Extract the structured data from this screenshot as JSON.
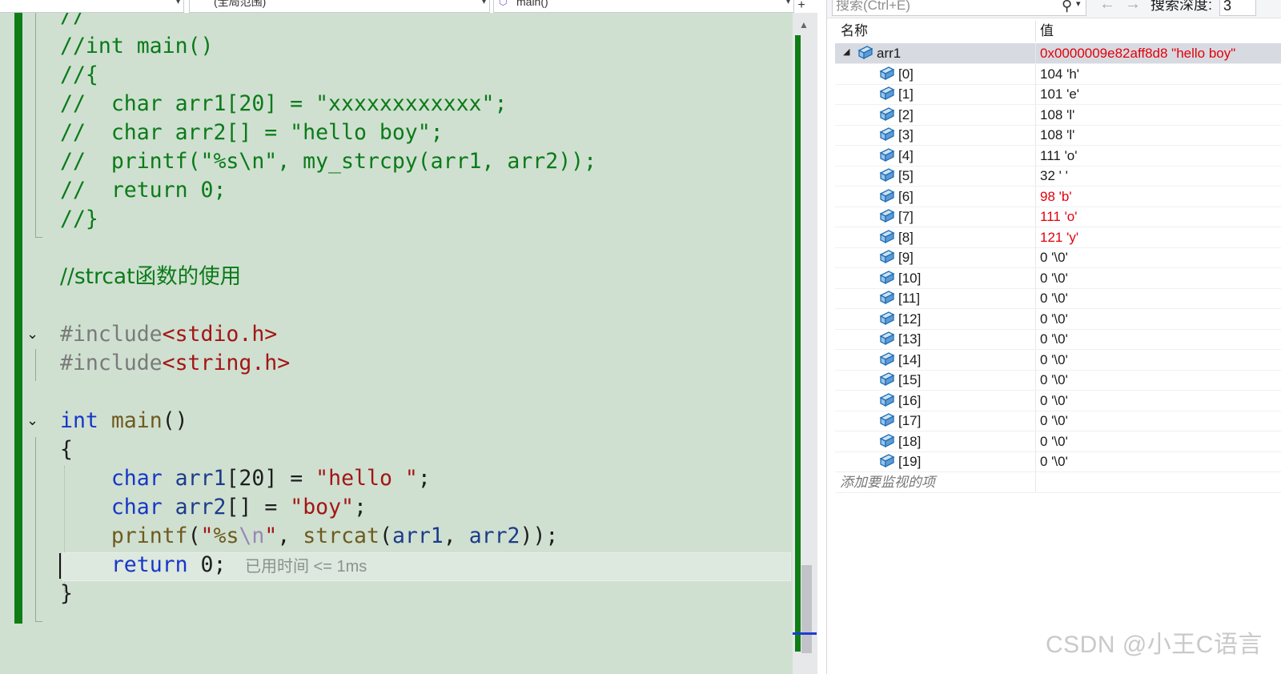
{
  "navbar": {
    "scope": "(全局范围)",
    "method": "main()",
    "split": "+"
  },
  "code": {
    "lines": [
      "//",
      "//int main()",
      "//{",
      "//  char arr1[20] = \"xxxxxxxxxxxx\";",
      "//  char arr2[] = \"hello boy\";",
      "//  printf(\"%s\\n\", my_strcpy(arr1, arr2));",
      "//  return 0;",
      "//}",
      "",
      "//strcat函数的使用",
      "",
      "#include<stdio.h>",
      "#include<string.h>",
      "",
      "int main()",
      "{",
      "    char arr1[20] = \"hello \";",
      "    char arr2[] = \"boy\";",
      "    printf(\"%s\\n\", strcat(arr1, arr2));",
      "    return 0;",
      "}"
    ],
    "perf_tip": "已用时间 <= 1ms"
  },
  "watch": {
    "search_placeholder": "搜索(Ctrl+E)",
    "depth_label": "搜索深度:",
    "depth_value": "3",
    "col_name": "名称",
    "col_value": "值",
    "root": {
      "name": "arr1",
      "value": "0x0000009e82aff8d8 \"hello boy\"",
      "expanded": true,
      "changed": true
    },
    "items": [
      {
        "name": "[0]",
        "value": "104 'h'",
        "changed": false
      },
      {
        "name": "[1]",
        "value": "101 'e'",
        "changed": false
      },
      {
        "name": "[2]",
        "value": "108 'l'",
        "changed": false
      },
      {
        "name": "[3]",
        "value": "108 'l'",
        "changed": false
      },
      {
        "name": "[4]",
        "value": "111 'o'",
        "changed": false
      },
      {
        "name": "[5]",
        "value": "32 ' '",
        "changed": false
      },
      {
        "name": "[6]",
        "value": "98 'b'",
        "changed": true
      },
      {
        "name": "[7]",
        "value": "111 'o'",
        "changed": true
      },
      {
        "name": "[8]",
        "value": "121 'y'",
        "changed": true
      },
      {
        "name": "[9]",
        "value": "0 '\\0'",
        "changed": false
      },
      {
        "name": "[10]",
        "value": "0 '\\0'",
        "changed": false
      },
      {
        "name": "[11]",
        "value": "0 '\\0'",
        "changed": false
      },
      {
        "name": "[12]",
        "value": "0 '\\0'",
        "changed": false
      },
      {
        "name": "[13]",
        "value": "0 '\\0'",
        "changed": false
      },
      {
        "name": "[14]",
        "value": "0 '\\0'",
        "changed": false
      },
      {
        "name": "[15]",
        "value": "0 '\\0'",
        "changed": false
      },
      {
        "name": "[16]",
        "value": "0 '\\0'",
        "changed": false
      },
      {
        "name": "[17]",
        "value": "0 '\\0'",
        "changed": false
      },
      {
        "name": "[18]",
        "value": "0 '\\0'",
        "changed": false
      },
      {
        "name": "[19]",
        "value": "0 '\\0'",
        "changed": false
      }
    ],
    "add_item": "添加要监视的项"
  },
  "watermark": "CSDN @小王C语言",
  "colors": {
    "editor_bg": "#cfe0d0",
    "change_bar": "#0f7d15",
    "comment": "#0b7a19",
    "keyword": "#1736c8",
    "string": "#a31515",
    "changed_value": "#e3000b"
  },
  "icons": [
    "chevron-down-icon",
    "method-cube-icon",
    "search-icon",
    "arrow-left-icon",
    "arrow-right-icon",
    "expand-triangle-icon",
    "variable-icon",
    "fold-icon"
  ]
}
